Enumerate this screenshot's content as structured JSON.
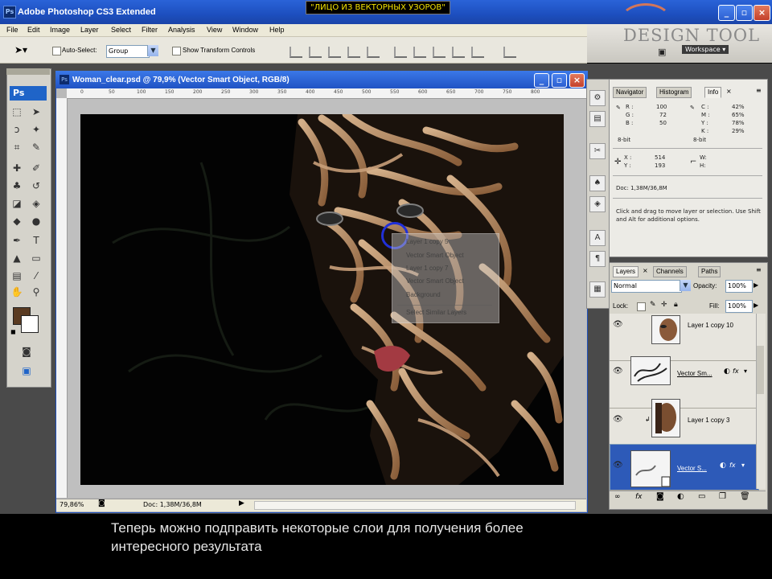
{
  "window": {
    "app_title": "Adobe Photoshop CS3 Extended",
    "video_caption": "\"ЛИЦО ИЗ ВЕКТОРНЫХ УЗОРОВ\"",
    "ps_icon": "Ps"
  },
  "menu": [
    "File",
    "Edit",
    "Image",
    "Layer",
    "Select",
    "Filter",
    "Analysis",
    "View",
    "Window",
    "Help"
  ],
  "options_bar": {
    "auto_select_label": "Auto-Select:",
    "auto_select_value": "Group",
    "show_transform_label": "Show Transform Controls",
    "workspace_label": "Workspace ▾"
  },
  "logo": {
    "text": "DESIGN TOOL"
  },
  "toolbox": {
    "ps_label": "Ps"
  },
  "document": {
    "title": "Woman_clear.psd @ 79,9% (Vector Smart Object, RGB/8)",
    "ruler_marks": [
      "0",
      "50",
      "100",
      "150",
      "200",
      "250",
      "300",
      "350",
      "400",
      "450",
      "500",
      "550",
      "600",
      "650",
      "700",
      "750",
      "800"
    ],
    "zoom": "79,86%",
    "doc_size": "Doc: 1,38M/36,8M"
  },
  "context_menu": {
    "items": [
      "Layer 1 copy 5",
      "Vector Smart Object",
      "Layer 1 copy 7",
      "Vector Smart Object",
      "Background",
      "Select Similar Layers"
    ]
  },
  "info_panel": {
    "tabs": [
      "Navigator",
      "Histogram",
      "Info"
    ],
    "active_tab": "Info",
    "rgb": {
      "R": "100",
      "G": "72",
      "B": "50"
    },
    "cmyk": {
      "C": "42%",
      "M": "65%",
      "Y": "78%",
      "K": "29%"
    },
    "bit_left": "8-bit",
    "bit_right": "8-bit",
    "x": "514",
    "y": "193",
    "w_label": "W:",
    "h_label": "H:",
    "doc": "Doc: 1,38M/36,8M",
    "hint": "Click and drag to move layer or selection. Use Shift and Alt for additional options."
  },
  "layers_panel": {
    "tabs": [
      "Layers",
      "Channels",
      "Paths"
    ],
    "active_tab": "Layers",
    "blend_mode": "Normal",
    "opacity_label": "Opacity:",
    "opacity_value": "100%",
    "lock_label": "Lock:",
    "fill_label": "Fill:",
    "fill_value": "100%",
    "layers": [
      {
        "name": "Layer 1 copy 10",
        "selected": false
      },
      {
        "name": "Vector Sm...",
        "selected": false
      },
      {
        "name": "Layer 1 copy 3",
        "selected": false
      },
      {
        "name": "Vector S...",
        "selected": true
      }
    ]
  },
  "subtitle": {
    "line1": "Теперь можно подправить некоторые слои для получения более",
    "line2": "интересного результата"
  },
  "colors": {
    "titlebar": "#2053c4",
    "selection": "#2d5ab8",
    "foreground_color": "#5a3b22",
    "subtitle_yellow": "#f5e400"
  }
}
